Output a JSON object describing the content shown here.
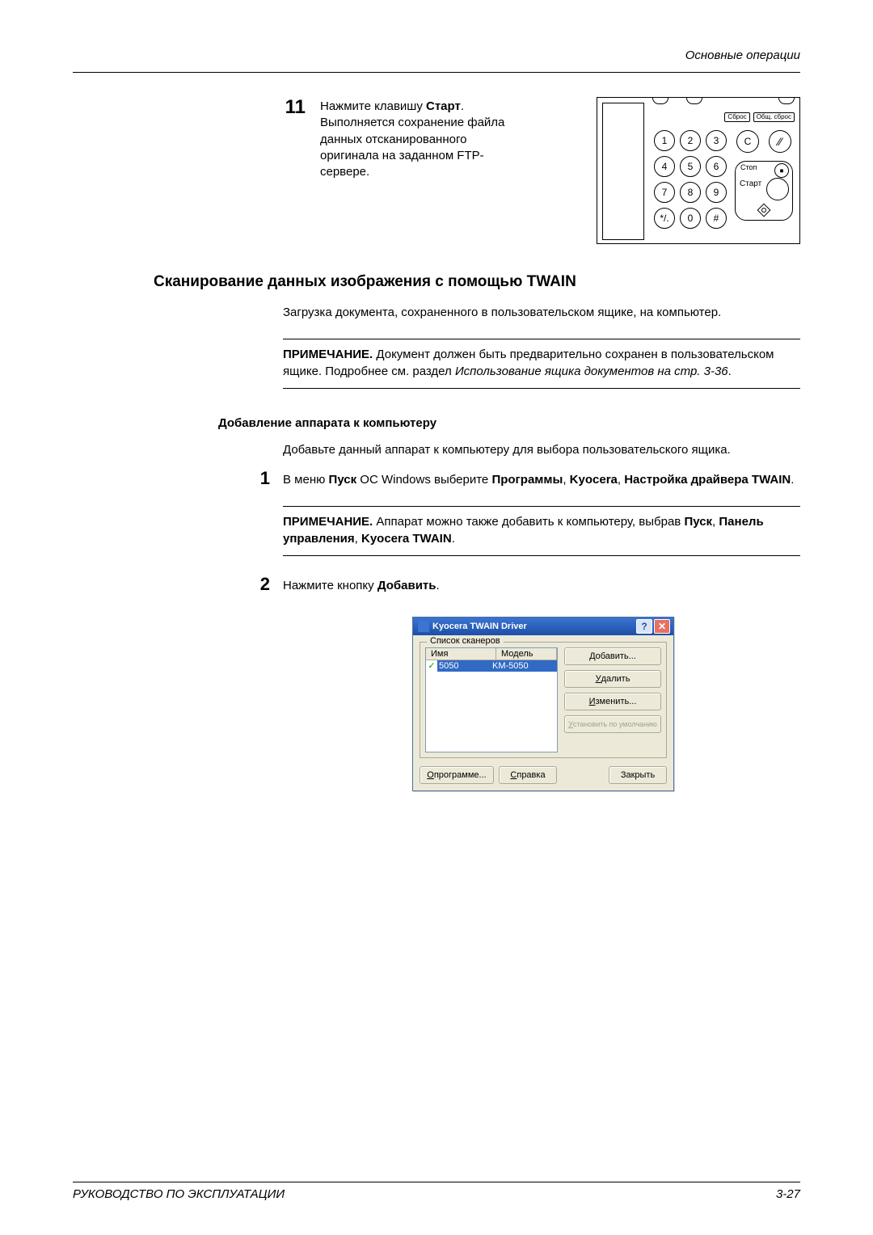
{
  "header": {
    "section": "Основные операции"
  },
  "step11": {
    "num": "11",
    "line1a": "Нажмите клавишу ",
    "line1b": "Старт",
    "line1c": ". Выполняется сохранение файла данных отсканированного оригинала на заданном FTP-сервере."
  },
  "panel": {
    "labels": {
      "reset": "Сброс",
      "allReset": "Общ. сброс",
      "stop": "Стоп",
      "start": "Старт"
    },
    "keys": [
      "1",
      "2",
      "3",
      "4",
      "5",
      "6",
      "7",
      "8",
      "9",
      "*/.",
      "0",
      "#"
    ],
    "c": "C"
  },
  "twain": {
    "heading": "Сканирование данных изображения с помощью TWAIN",
    "intro": "Загрузка документа, сохраненного в пользовательском ящике, на компьютер.",
    "note1a": "ПРИМЕЧАНИЕ.",
    "note1b": " Документ должен быть предварительно сохранен в пользовательском ящике. Подробнее см. раздел ",
    "note1c": "Использование ящика документов на стр. 3-36",
    "note1d": "."
  },
  "addDev": {
    "heading": "Добавление аппарата к компьютеру",
    "intro": "Добавьте данный аппарат к компьютеру для выбора пользовательского ящика.",
    "s1": {
      "num": "1",
      "a": "В меню ",
      "b": "Пуск",
      "c": " ОС Windows выберите ",
      "d": "Программы",
      "e": ", ",
      "f": "Kyocera",
      "g": ", ",
      "h": "Настройка драйвера TWAIN",
      "i": "."
    },
    "note2a": "ПРИМЕЧАНИЕ.",
    "note2b": " Аппарат можно также добавить к компьютеру, выбрав ",
    "note2c": "Пуск",
    "note2d": ", ",
    "note2e": "Панель управления",
    "note2f": ", ",
    "note2g": "Kyocera TWAIN",
    "note2h": ".",
    "s2": {
      "num": "2",
      "a": "Нажмите кнопку ",
      "b": "Добавить",
      "c": "."
    }
  },
  "dialog": {
    "title": "Kyocera TWAIN Driver",
    "group": "Список сканеров",
    "colName": "Имя",
    "colModel": "Модель",
    "rowName": "5050",
    "rowModel": "KM-5050",
    "btnAdd": "обавить...",
    "btnAddU": "Д",
    "btnDel": "далить",
    "btnDelU": "У",
    "btnEdit": "зменить...",
    "btnEditU": "И",
    "btnDefault": "становить по умолчанию",
    "btnDefaultU": "У",
    "btnAbout": " программе...",
    "btnAboutU": "О",
    "btnHelp": "правка",
    "btnHelpU": "С",
    "btnClose": "Закрыть"
  },
  "footer": {
    "left": "РУКОВОДСТВО ПО ЭКСПЛУАТАЦИИ",
    "right": "3-27"
  }
}
